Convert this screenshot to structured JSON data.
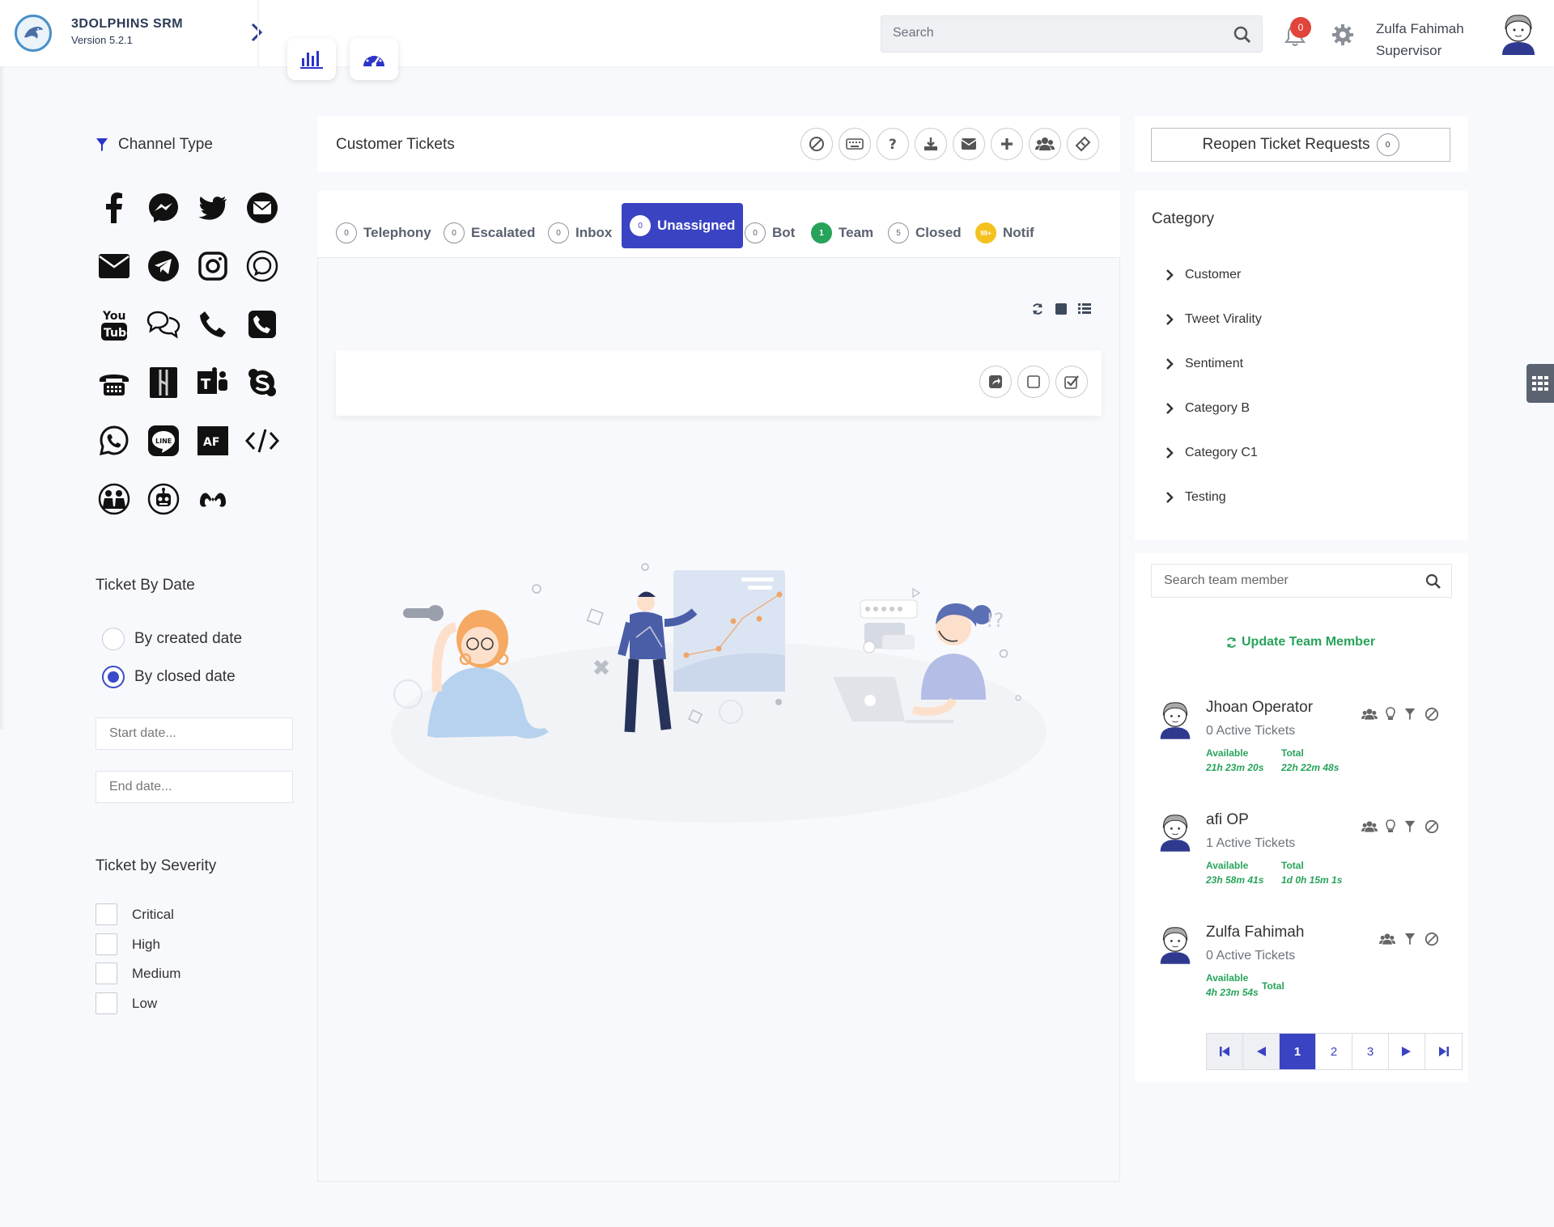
{
  "app": {
    "name": "3DOLPHINS SRM",
    "version": "Version 5.2.1"
  },
  "header": {
    "search_placeholder": "Search",
    "notification_count": "0",
    "user_name": "Zulfa Fahimah",
    "user_role": "Supervisor"
  },
  "filters": {
    "channel_type_title": "Channel Type",
    "channels": [
      "facebook-icon",
      "messenger-icon",
      "twitter-icon",
      "email-circle-icon",
      "email-icon",
      "telegram-icon",
      "instagram-icon",
      "chat-bubble-icon",
      "youtube-icon",
      "livechat-icon",
      "phone-icon",
      "phone-box-icon",
      "telephone-icon",
      "xray-icon",
      "teams-icon",
      "skype-icon",
      "whatsapp-icon",
      "line-icon",
      "af-icon",
      "code-icon",
      "meeting-icon",
      "bot-icon",
      "meta-icon"
    ],
    "ticket_by_date_title": "Ticket By Date",
    "by_created": "By created date",
    "by_closed": "By closed date",
    "start_placeholder": "Start date...",
    "end_placeholder": "End date...",
    "severity_title": "Ticket by Severity",
    "severities": [
      "Critical",
      "High",
      "Medium",
      "Low"
    ]
  },
  "tickets": {
    "title": "Customer Tickets",
    "tabs": [
      {
        "label": "Telephony",
        "count": "0"
      },
      {
        "label": "Escalated",
        "count": "0"
      },
      {
        "label": "Inbox",
        "count": "0"
      },
      {
        "label": "Unassigned",
        "count": "0"
      },
      {
        "label": "Bot",
        "count": "0"
      },
      {
        "label": "Team",
        "count": "1"
      },
      {
        "label": "Closed",
        "count": "5"
      },
      {
        "label": "Notif",
        "count": "99+"
      }
    ]
  },
  "reopen": {
    "label": "Reopen Ticket Requests",
    "count": "0"
  },
  "category": {
    "title": "Category",
    "items": [
      "Customer",
      "Tweet Virality",
      "Sentiment",
      "Category B",
      "Category C1",
      "Testing"
    ]
  },
  "team": {
    "search_placeholder": "Search team member",
    "update_label": "Update Team Member",
    "available_label": "Available",
    "total_label": "Total",
    "members": [
      {
        "name": "Jhoan Operator",
        "active": "0 Active Tickets",
        "available": "21h 23m 20s",
        "total": "22h 22m 48s"
      },
      {
        "name": "afi OP",
        "active": "1 Active Tickets",
        "available": "23h 58m 41s",
        "total": "1d 0h 15m 1s"
      },
      {
        "name": "Zulfa Fahimah",
        "active": "0 Active Tickets",
        "available": "4h 23m 54s",
        "total": ""
      }
    ],
    "pages": [
      "1",
      "2",
      "3"
    ]
  },
  "colors": {
    "primary": "#3a43c2",
    "success": "#27a35a",
    "danger": "#e0443a",
    "warning": "#f4c21f"
  }
}
